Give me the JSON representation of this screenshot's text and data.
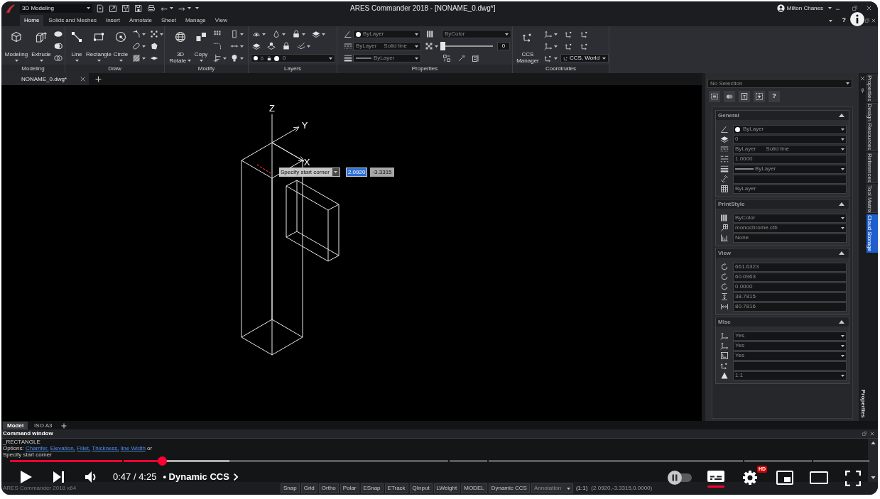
{
  "app": {
    "title_bar": {
      "workspace": "3D Modeling",
      "title": "ARES Commander 2018 - [NONAME_0.dwg*]",
      "user": "Milton Chanes"
    },
    "ribbon_tabs": [
      {
        "label": "Home",
        "selected": true
      },
      {
        "label": "Solids and Meshes",
        "selected": false
      },
      {
        "label": "Insert",
        "selected": false
      },
      {
        "label": "Annotate",
        "selected": false
      },
      {
        "label": "Sheet",
        "selected": false
      },
      {
        "label": "Manage",
        "selected": false
      },
      {
        "label": "View",
        "selected": false
      }
    ],
    "help_button": "?",
    "ribbon": {
      "modeling": {
        "title": "Modeling",
        "buttons": [
          "Modeling",
          "Extrude"
        ]
      },
      "draw": {
        "title": "Draw",
        "buttons": [
          "Line",
          "Rectangle",
          "Circle"
        ]
      },
      "modify": {
        "title": "Modify",
        "buttons": [
          "3D Rotate",
          "Copy"
        ]
      },
      "layers": {
        "title": "Layers",
        "layer": "0"
      },
      "properties": {
        "title": "Properties",
        "color_setting": "ByLayer",
        "linetype": "ByLayer",
        "linetype_name": "Solid line",
        "lineweight": "ByLayer",
        "print_style": "ByColor",
        "transparency": {
          "level": 0,
          "value": "0"
        }
      },
      "coordinates": {
        "title": "Coordinates",
        "button": "CCS Manager",
        "ccs": "CCS, World"
      }
    },
    "document_tabs": [
      {
        "label": "NONAME_0.dwg*",
        "selected": true
      }
    ],
    "canvas": {
      "axes": [
        "Z",
        "Y",
        "X"
      ],
      "prompt": "Specify start corner",
      "inputs": [
        {
          "value": "2.0920",
          "selected": true
        },
        {
          "value": "-3.3315",
          "selected": false
        }
      ]
    },
    "properties_palette": {
      "selection": "No Selection",
      "help_button": "?",
      "sections": [
        {
          "title": "General",
          "expanded": true,
          "rows": [
            {
              "kind": "color",
              "value": "ByLayer",
              "dropdown": true
            },
            {
              "kind": "text",
              "value": "0",
              "dropdown": true
            },
            {
              "kind": "text",
              "value": "ByLayer",
              "detail": "Solid line",
              "dropdown": true
            },
            {
              "kind": "text",
              "value": "1.0000",
              "dropdown": false
            },
            {
              "kind": "lineweight",
              "value": "ByLayer",
              "dropdown": true
            },
            {
              "kind": "text",
              "dropdown": false
            },
            {
              "kind": "text",
              "value": "ByLayer",
              "dropdown": false
            }
          ]
        },
        {
          "title": "PrintStyle",
          "expanded": true,
          "rows": [
            {
              "kind": "text",
              "value": "ByColor",
              "dropdown": true
            },
            {
              "kind": "text",
              "value": "monochrome.ctb",
              "dropdown": true
            },
            {
              "kind": "text",
              "value": "None",
              "dropdown": false
            }
          ]
        },
        {
          "title": "View",
          "expanded": true,
          "rows": [
            {
              "kind": "text",
              "value": "661.6323",
              "dropdown": false
            },
            {
              "kind": "text",
              "value": "60.0963",
              "dropdown": false
            },
            {
              "kind": "text",
              "value": "0.0000",
              "dropdown": false
            },
            {
              "kind": "text",
              "value": "38.7815",
              "dropdown": false
            },
            {
              "kind": "text",
              "value": "80.7816",
              "dropdown": false
            }
          ]
        },
        {
          "title": "Misc",
          "expanded": true,
          "rows": [
            {
              "kind": "text",
              "value": "Yes",
              "dropdown": true
            },
            {
              "kind": "text",
              "value": "Yes",
              "dropdown": true
            },
            {
              "kind": "text",
              "value": "Yes",
              "dropdown": true
            },
            {
              "kind": "text",
              "dropdown": false
            },
            {
              "kind": "text",
              "value": "1:1",
              "dropdown": true
            }
          ]
        }
      ]
    },
    "palette_title": "Properties",
    "side_tabs": [
      {
        "label": "Properties",
        "selected": false
      },
      {
        "label": "Design Resources",
        "selected": false
      },
      {
        "label": "References",
        "selected": false
      },
      {
        "label": "Tool Matrix",
        "selected": false
      },
      {
        "label": "Cloud Storage",
        "selected": true
      }
    ],
    "layout_tabs": [
      {
        "label": "Model",
        "selected": true
      },
      {
        "label": "ISO A3",
        "selected": false
      }
    ],
    "command_window": {
      "title": "Command window",
      "lines": [
        {
          "kind": "text",
          "text": "_RECTANGLE"
        },
        {
          "kind": "options",
          "text": "Options:",
          "options": [
            "Chamfer,",
            "Elevation,",
            "Fillet,",
            "Thickness,",
            "line Width"
          ],
          "suffix": "or"
        },
        {
          "kind": "text",
          "text": "Specify start corner"
        }
      ]
    },
    "status_bar": {
      "app": "ARES Commander 2018 x64",
      "toggles": [
        "Snap",
        "Grid",
        "Ortho",
        "Polar",
        "ESnap",
        "ETrack",
        "QInput",
        "LWeight",
        "MODEL",
        "Dynamic CCS"
      ],
      "annotation": "Annotation",
      "scale": "(1:1)",
      "coordinates": "(2.0920,-3.3315,0.0000)"
    }
  },
  "player": {
    "progress": {
      "level": 0.177,
      "loaded": {
        "level": 0.255
      }
    },
    "time": "0:47 / 4:25",
    "chapter": "• Dynamic CCS",
    "autoplay": false,
    "captions": true,
    "quality_badge": "HD"
  }
}
